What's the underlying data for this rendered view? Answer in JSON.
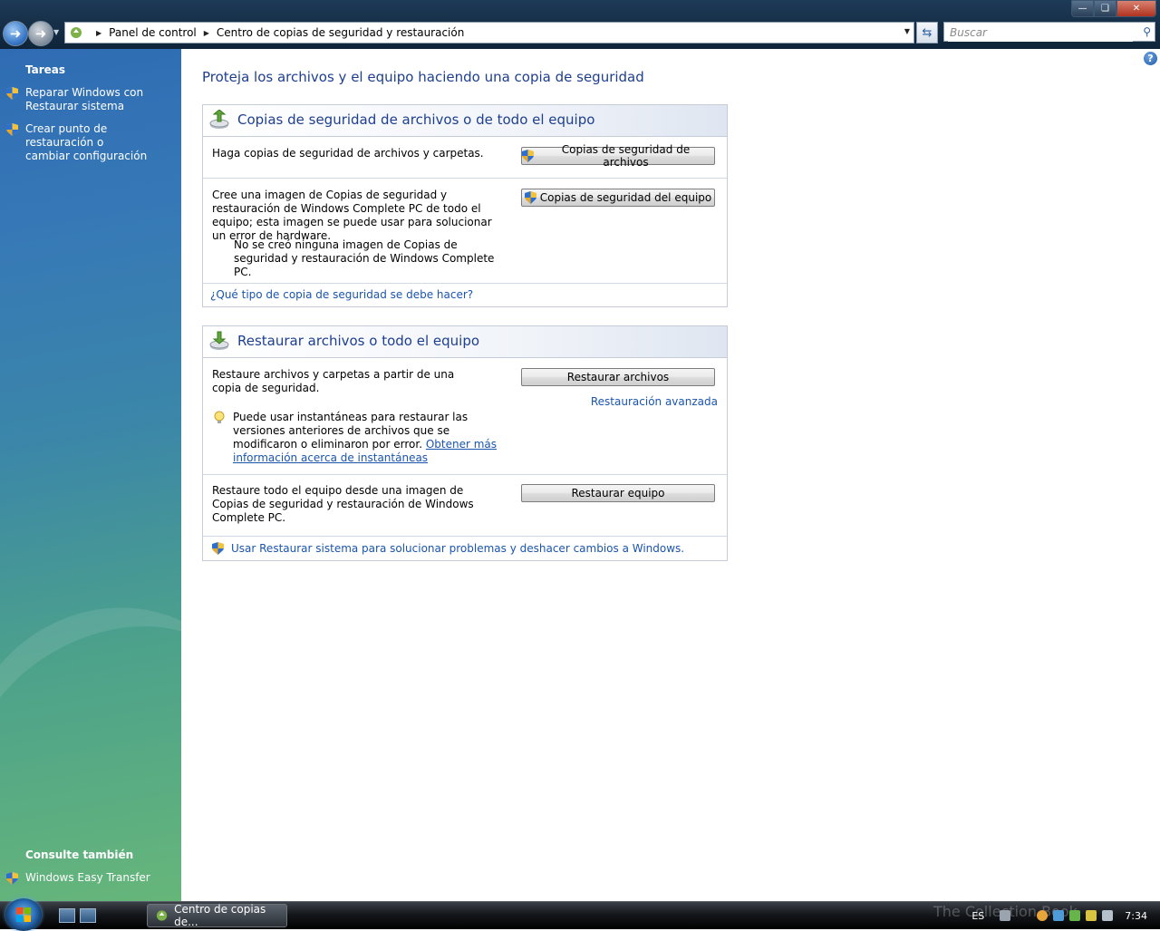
{
  "address_bar": {
    "breadcrumbs": [
      "Panel de control",
      "Centro de copias de seguridad y restauración"
    ]
  },
  "search": {
    "placeholder": "Buscar"
  },
  "task_pane": {
    "tasks_heading": "Tareas",
    "tasks": [
      {
        "label_line1": "Reparar Windows con",
        "label_line2": "Restaurar sistema"
      },
      {
        "label_line1": "Crear punto de restauración o",
        "label_line2": "cambiar configuración"
      }
    ],
    "see_also_heading": "Consulte también",
    "see_also": [
      {
        "label": "Windows Easy Transfer"
      }
    ]
  },
  "main": {
    "title": "Proteja los archivos y el equipo haciendo una copia de seguridad",
    "backup_section": {
      "title": "Copias de seguridad de archivos o de todo el equipo",
      "file_backup_text": "Haga copias de seguridad de archivos y carpetas.",
      "file_backup_button": "Copias de seguridad de archivos",
      "pc_backup_text": "Cree una imagen de Copias de seguridad y restauración de Windows Complete PC de todo el equipo; esta imagen se puede usar para solucionar un error de hardware.",
      "pc_backup_status": "No se creó ninguna imagen de Copias de seguridad y restauración de Windows Complete PC.",
      "pc_backup_button": "Copias de seguridad del equipo",
      "help_link": "¿Qué tipo de copia de seguridad se debe hacer?"
    },
    "restore_section": {
      "title": "Restaurar archivos o todo el equipo",
      "restore_files_text": "Restaure archivos y carpetas a partir de una copia de seguridad.",
      "restore_files_button": "Restaurar archivos",
      "advanced_restore_link": "Restauración avanzada",
      "tip_text": "Puede usar instantáneas para restaurar las versiones anteriores de archivos que se modificaron o eliminaron por error.",
      "tip_link": "Obtener más información acerca de instantáneas",
      "restore_pc_text": "Restaure todo el equipo desde una imagen de Copias de seguridad y restauración de Windows Complete PC.",
      "restore_pc_button": "Restaurar equipo",
      "system_restore_link": "Usar Restaurar sistema para solucionar problemas y deshacer cambios a Windows."
    }
  },
  "taskbar": {
    "task_button": "Centro de copias de...",
    "language": "ES",
    "clock": "7:34",
    "watermark": "The Collection Book"
  },
  "colors": {
    "link": "#1a55ad",
    "heading": "#1e3f8f",
    "pane_top": "#2f6cb3",
    "pane_bottom": "#66b67a"
  }
}
